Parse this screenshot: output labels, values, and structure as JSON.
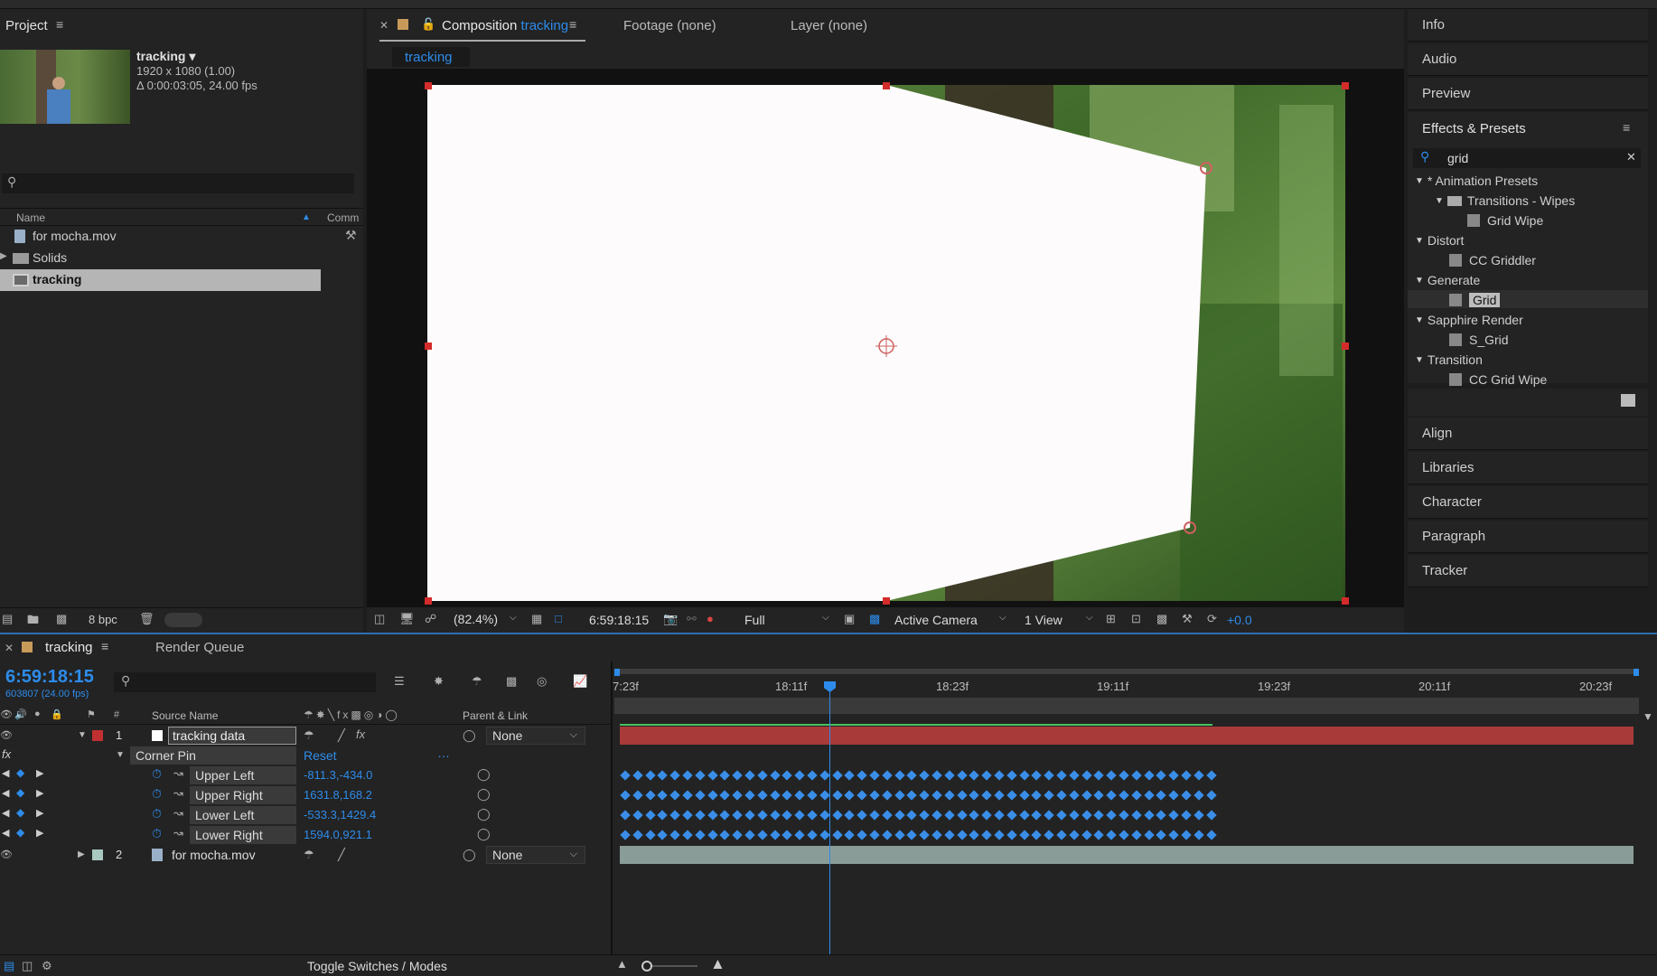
{
  "project": {
    "title": "Project",
    "comp_name": "tracking ▾",
    "comp_res": "1920 x 1080 (1.00)",
    "comp_duration": "Δ 0:00:03:05, 24.00 fps",
    "col_name": "Name",
    "col_comment": "Comm",
    "items": [
      {
        "label": "for mocha.mov",
        "type": "footage"
      },
      {
        "label": "Solids",
        "type": "folder"
      },
      {
        "label": "tracking",
        "type": "composition"
      }
    ],
    "bpc": "8 bpc"
  },
  "comp_panel": {
    "tab_prefix": "Composition",
    "tab_name": "tracking",
    "footage_tab": "Footage (none)",
    "layer_tab": "Layer (none)",
    "breadcrumb": "tracking",
    "zoom": "(82.4%)",
    "timecode": "6:59:18:15",
    "resolution": "Full",
    "camera": "Active Camera",
    "views": "1 View",
    "exposure": "+0.0"
  },
  "right_panel": {
    "sections_top": [
      "Info",
      "Audio",
      "Preview"
    ],
    "effects_title": "Effects & Presets",
    "search_value": "grid",
    "tree": [
      {
        "label": "* Animation Presets",
        "level": 0,
        "kind": "group"
      },
      {
        "label": "Transitions - Wipes",
        "level": 1,
        "kind": "folder"
      },
      {
        "label": "Grid Wipe",
        "level": 2,
        "kind": "preset"
      },
      {
        "label": "Distort",
        "level": 0,
        "kind": "group"
      },
      {
        "label": "CC Griddler",
        "level": 1,
        "kind": "effect"
      },
      {
        "label": "Generate",
        "level": 0,
        "kind": "group"
      },
      {
        "label": "Grid",
        "level": 1,
        "kind": "effect",
        "selected": true
      },
      {
        "label": "Sapphire Render",
        "level": 0,
        "kind": "group"
      },
      {
        "label": "S_Grid",
        "level": 1,
        "kind": "effect"
      },
      {
        "label": "Transition",
        "level": 0,
        "kind": "group"
      },
      {
        "label": "CC Grid Wipe",
        "level": 1,
        "kind": "effect"
      }
    ],
    "sections_bottom": [
      "Align",
      "Libraries",
      "Character",
      "Paragraph",
      "Tracker"
    ]
  },
  "timeline": {
    "tab_name": "tracking",
    "render_queue": "Render Queue",
    "timecode": "6:59:18:15",
    "frame_info": "603807 (24.00 fps)",
    "col_source_name": "Source Name",
    "col_parent": "Parent & Link",
    "col_hash": "#",
    "ticks": [
      "7:23f",
      "18:11f",
      "18:23f",
      "19:11f",
      "19:23f",
      "20:11f",
      "20:23f"
    ],
    "layers": [
      {
        "num": "1",
        "name": "tracking data",
        "parent": "None",
        "color": "#c13030"
      },
      {
        "num": "2",
        "name": "for mocha.mov",
        "parent": "None",
        "color": "#a8c8c0"
      }
    ],
    "effect": {
      "name": "Corner Pin",
      "reset": "Reset"
    },
    "properties": [
      {
        "name": "Upper Left",
        "value": "-811.3,-434.0"
      },
      {
        "name": "Upper Right",
        "value": "1631.8,168.2"
      },
      {
        "name": "Lower Left",
        "value": "-533.3,1429.4"
      },
      {
        "name": "Lower Right",
        "value": "1594.0,921.1"
      }
    ],
    "keyframes_per_row": 48,
    "toggle_label": "Toggle Switches / Modes"
  },
  "colors": {
    "accent": "#2d8ceb",
    "layer1_bar": "#a83a3a",
    "layer2_bar": "#8a9c98"
  }
}
